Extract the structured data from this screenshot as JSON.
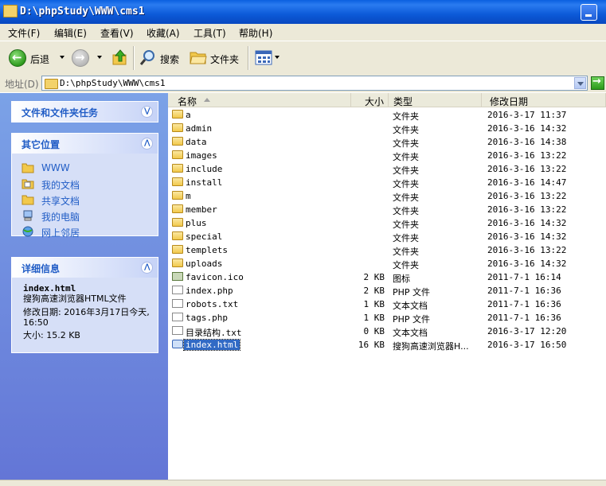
{
  "window": {
    "title": "D:\\phpStudy\\WWW\\cms1"
  },
  "menu": [
    "文件(F)",
    "编辑(E)",
    "查看(V)",
    "收藏(A)",
    "工具(T)",
    "帮助(H)"
  ],
  "toolbar": {
    "back_label": "后退",
    "search_label": "搜索",
    "folders_label": "文件夹"
  },
  "address": {
    "label": "地址(D)",
    "value": "D:\\phpStudy\\WWW\\cms1"
  },
  "tasks": {
    "file_tasks_title": "文件和文件夹任务",
    "other_places_title": "其它位置",
    "other_places": [
      "WWW",
      "我的文档",
      "共享文档",
      "我的电脑",
      "网上邻居"
    ],
    "details_title": "详细信息",
    "details": {
      "name": "index.html",
      "type": "搜狗高速浏览器HTML文件",
      "modified": "修改日期: 2016年3月17日今天, 16:50",
      "size": "大小: 15.2 KB"
    }
  },
  "columns": {
    "name": "名称",
    "size": "大小",
    "type": "类型",
    "modified": "修改日期"
  },
  "files": [
    {
      "name": "a",
      "size": "",
      "type": "文件夹",
      "date": "2016-3-17 11:37",
      "kind": "folder"
    },
    {
      "name": "admin",
      "size": "",
      "type": "文件夹",
      "date": "2016-3-16 14:32",
      "kind": "folder"
    },
    {
      "name": "data",
      "size": "",
      "type": "文件夹",
      "date": "2016-3-16 14:38",
      "kind": "folder"
    },
    {
      "name": "images",
      "size": "",
      "type": "文件夹",
      "date": "2016-3-16 13:22",
      "kind": "folder"
    },
    {
      "name": "include",
      "size": "",
      "type": "文件夹",
      "date": "2016-3-16 13:22",
      "kind": "folder"
    },
    {
      "name": "install",
      "size": "",
      "type": "文件夹",
      "date": "2016-3-16 14:47",
      "kind": "folder"
    },
    {
      "name": "m",
      "size": "",
      "type": "文件夹",
      "date": "2016-3-16 13:22",
      "kind": "folder"
    },
    {
      "name": "member",
      "size": "",
      "type": "文件夹",
      "date": "2016-3-16 13:22",
      "kind": "folder"
    },
    {
      "name": "plus",
      "size": "",
      "type": "文件夹",
      "date": "2016-3-16 14:32",
      "kind": "folder"
    },
    {
      "name": "special",
      "size": "",
      "type": "文件夹",
      "date": "2016-3-16 14:32",
      "kind": "folder"
    },
    {
      "name": "templets",
      "size": "",
      "type": "文件夹",
      "date": "2016-3-16 13:22",
      "kind": "folder"
    },
    {
      "name": "uploads",
      "size": "",
      "type": "文件夹",
      "date": "2016-3-16 14:32",
      "kind": "folder"
    },
    {
      "name": "favicon.ico",
      "size": "2 KB",
      "type": "图标",
      "date": "2011-7-1 16:14",
      "kind": "ico"
    },
    {
      "name": "index.php",
      "size": "2 KB",
      "type": "PHP 文件",
      "date": "2011-7-1 16:36",
      "kind": "file"
    },
    {
      "name": "robots.txt",
      "size": "1 KB",
      "type": "文本文档",
      "date": "2011-7-1 16:36",
      "kind": "file"
    },
    {
      "name": "tags.php",
      "size": "1 KB",
      "type": "PHP 文件",
      "date": "2011-7-1 16:36",
      "kind": "file"
    },
    {
      "name": "目录结构.txt",
      "size": "0 KB",
      "type": "文本文档",
      "date": "2016-3-17 12:20",
      "kind": "file"
    },
    {
      "name": "index.html",
      "size": "16 KB",
      "type": "搜狗高速浏览器H...",
      "date": "2016-3-17 16:50",
      "kind": "html",
      "selected": true
    }
  ]
}
